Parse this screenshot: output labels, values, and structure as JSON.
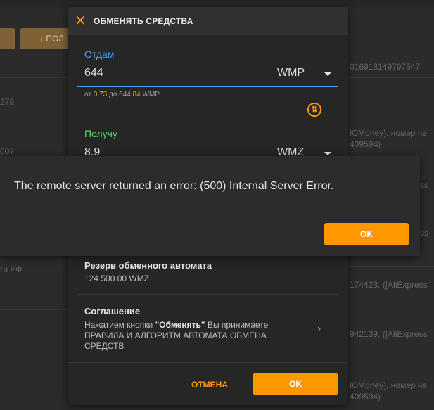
{
  "background": {
    "button_label": "↓ ПОЛ",
    "lines": [
      {
        "text": "016918149797547"
      },
      {
        "text": "279"
      },
      {
        "text": "ЮMoney), номер че"
      },
      {
        "text": "007"
      },
      {
        "text": "409594)"
      },
      {
        "text": "ss"
      },
      {
        "text": "ги РФ"
      },
      {
        "text": "174423. ([AliExpress"
      },
      {
        "text": "942139. ([AliExpress"
      },
      {
        "text": "ЮMoney), номер че"
      },
      {
        "text": "409594)"
      },
      {
        "text": "ss"
      }
    ]
  },
  "modal": {
    "title": "ОБМЕНЯТЬ СРЕДСТВА",
    "give": {
      "label": "Отдам",
      "value": "644",
      "currency": "WMP",
      "range_prefix": "от",
      "min": "0.73",
      "range_mid": "до",
      "max": "644.84",
      "range_currency": "WMP"
    },
    "receive": {
      "label": "Получу",
      "value": "8.9",
      "currency": "WMZ"
    },
    "reserve": {
      "title": "Резерв обменного автомата",
      "value": "124 500.00 WMZ"
    },
    "agreement": {
      "title": "Соглашение",
      "text_before": "Нажатием кнопки ",
      "button_quote": "\"Обменять\"",
      "text_after": " Вы принимаете ПРАВИЛА И АЛГОРИТМ АВТОМАТА ОБМЕНА СРЕДСТВ"
    },
    "cancel_label": "ОТМЕНА",
    "ok_label": "OK"
  },
  "error": {
    "message": "The remote server returned an error: (500) Internal Server Error.",
    "ok_label": "OK"
  },
  "colors": {
    "accent": "#ff9800",
    "link": "#4ba3ff",
    "green": "#5ad063"
  }
}
